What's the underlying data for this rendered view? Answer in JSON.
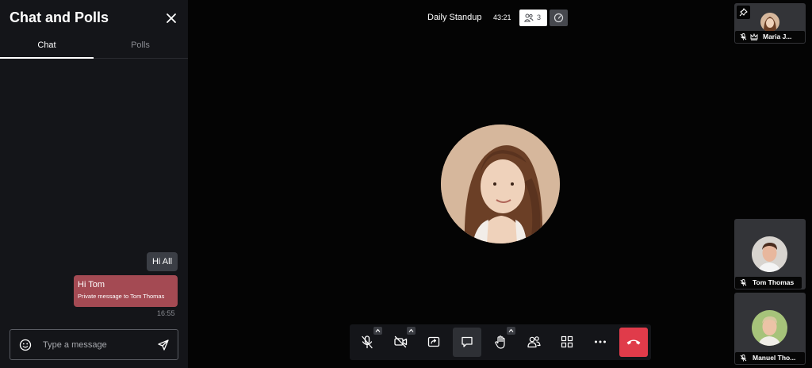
{
  "chat_panel": {
    "title": "Chat and Polls",
    "tabs": [
      {
        "label": "Chat",
        "active": true
      },
      {
        "label": "Polls",
        "active": false
      }
    ],
    "messages": [
      {
        "text": "Hi All",
        "type": "group"
      },
      {
        "text": "Hi Tom",
        "note": "Private message to Tom Thomas",
        "type": "private"
      }
    ],
    "last_time": "16:55",
    "input": {
      "placeholder": "Type a message",
      "value": ""
    }
  },
  "header": {
    "meeting_title": "Daily Standup",
    "timer": "43:21",
    "participant_count": "3"
  },
  "participants": [
    {
      "name": "Maria J...",
      "muted": true,
      "moderator": true,
      "pinned_control": true
    },
    {
      "name": "Tom Thomas",
      "muted": true
    },
    {
      "name": "Manuel Tho...",
      "muted": true
    }
  ],
  "toolbar": {
    "buttons": [
      "microphone-muted",
      "camera-off",
      "screen-share",
      "chat",
      "raise-hand",
      "participants",
      "tile-view",
      "more-options",
      "hang-up"
    ],
    "accent": "#e03b4a"
  },
  "colors": {
    "private_message_bg": "#a44a53",
    "panel_bg": "#141519",
    "stage_bg": "#040404"
  }
}
